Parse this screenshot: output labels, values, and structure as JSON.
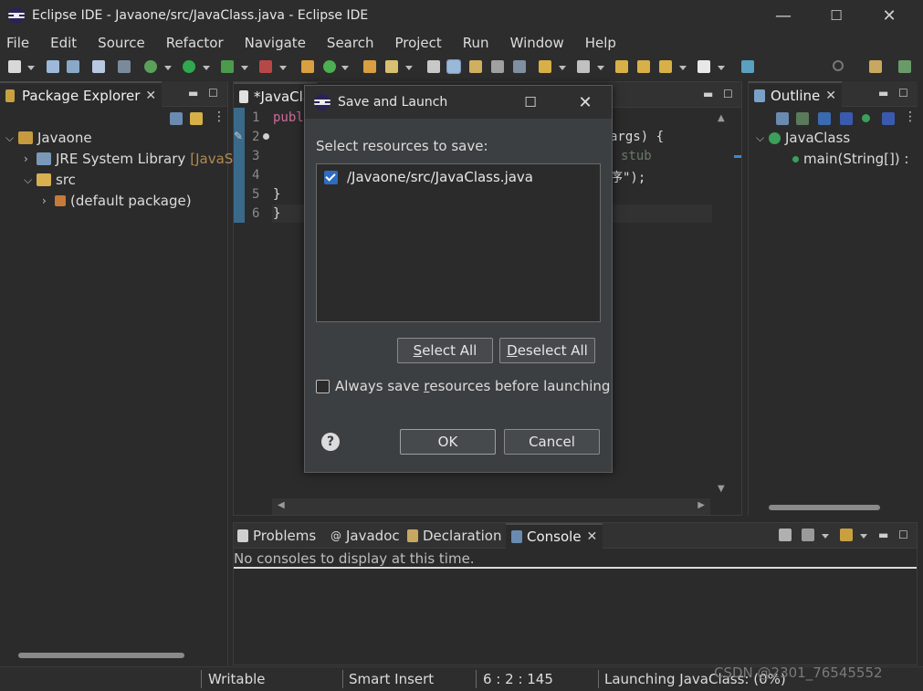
{
  "window": {
    "title": "Eclipse IDE - Javaone/src/JavaClass.java - Eclipse IDE",
    "controls": {
      "minimize": "—",
      "maximize": "☐",
      "close": "✕"
    }
  },
  "menu": [
    "File",
    "Edit",
    "Source",
    "Refactor",
    "Navigate",
    "Search",
    "Project",
    "Run",
    "Window",
    "Help"
  ],
  "package_explorer": {
    "tab_label": "Package Explorer",
    "tree": [
      {
        "label": "Javaone",
        "indent": 0,
        "expanded": true,
        "icon": "project-icon"
      },
      {
        "label": "JRE System Library",
        "suffix": "[JavaS",
        "indent": 1,
        "expanded": false,
        "icon": "library-icon"
      },
      {
        "label": "src",
        "indent": 1,
        "expanded": true,
        "icon": "package-folder-icon"
      },
      {
        "label": "(default package)",
        "indent": 2,
        "expanded": false,
        "icon": "package-icon"
      }
    ]
  },
  "editor": {
    "tab_label": "*JavaCla",
    "line_numbers": [
      "1",
      "2",
      "3",
      "4",
      "5",
      "6"
    ],
    "code_line1": "publ",
    "code_line2_tail": "args) {",
    "code_line3_tail": "stub",
    "code_line4_tail": "序\");",
    "code_line5": "}",
    "code_line6": "}"
  },
  "outline": {
    "tab_label": "Outline",
    "class_name": "JavaClass",
    "method": "main(String[]) :"
  },
  "bottom_tabs": [
    "Problems",
    "Javadoc",
    "Declaration",
    "Console"
  ],
  "console": {
    "message": "No consoles to display at this time."
  },
  "status": {
    "writable": "Writable",
    "insert_mode": "Smart Insert",
    "position": "6 : 2 : 145",
    "progress": "Launching JavaClass: (0%)",
    "watermark": "CSDN @2301_76545552"
  },
  "dialog": {
    "title": "Save and Launch",
    "prompt": "Select resources to save:",
    "resources": [
      {
        "path": "/Javaone/src/JavaClass.java",
        "checked": true
      }
    ],
    "select_all": "elect All",
    "select_all_mnemonic": "S",
    "deselect_all": "eselect All",
    "deselect_all_mnemonic": "D",
    "always_save_pre": "Always save ",
    "always_save_mnemonic": "r",
    "always_save_post": "esources before launching",
    "always_save_checked": false,
    "ok": "OK",
    "cancel": "Cancel",
    "help": "?"
  },
  "colors": {
    "accent": "#2d6cc0",
    "keyword": "#cc6c98",
    "background": "#2b2b2b"
  }
}
